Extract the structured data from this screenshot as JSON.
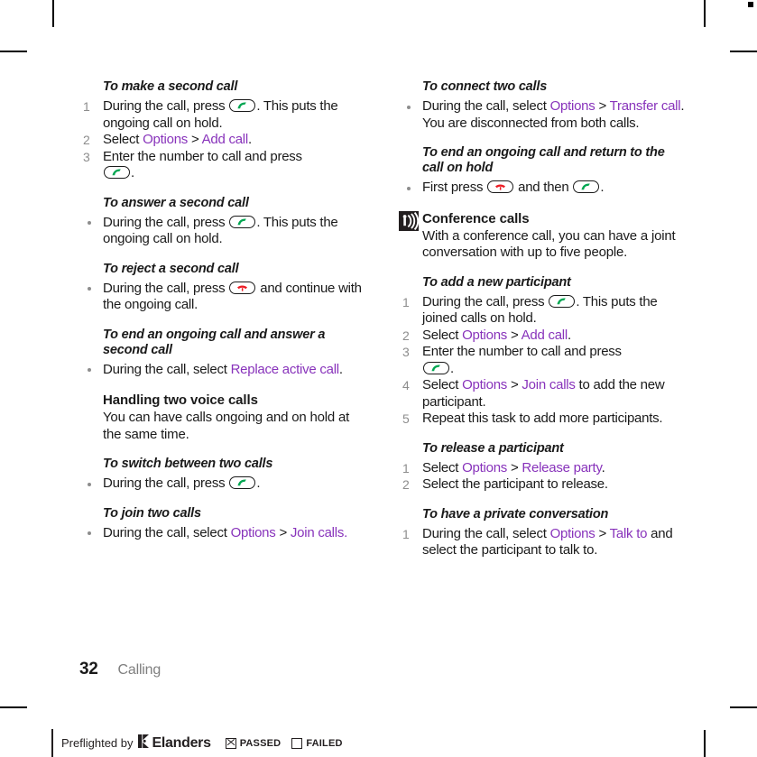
{
  "document": {
    "page_number": "32",
    "chapter": "Calling"
  },
  "left_column": {
    "blocks": [
      {
        "title": "To make a second call",
        "steps": [
          "During the call, press [CALL]. This puts the ongoing call on hold.",
          "Select Options > Add call.",
          "Enter the number to call and press [CALL]."
        ]
      },
      {
        "title": "To answer a second call",
        "steps": [
          "During the call, press [CALL]. This puts the ongoing call on hold."
        ]
      },
      {
        "title": "To reject a second call",
        "steps": [
          "During the call, press [END] and continue with the ongoing call."
        ]
      },
      {
        "title": "To end an ongoing call and answer a second call",
        "steps": [
          "During the call, select Replace active call."
        ]
      },
      {
        "heading": "Handling two voice calls",
        "body": "You can have calls ongoing and on hold at the same time."
      },
      {
        "title": "To switch between two calls",
        "steps": [
          "During the call, press [CALL]."
        ]
      },
      {
        "title": "To join two calls",
        "steps": [
          "During the call, select Options > Join calls."
        ]
      }
    ]
  },
  "right_column": {
    "blocks": [
      {
        "title": "To connect two calls",
        "steps": [
          "During the call, select Options > Transfer call. You are disconnected from both calls."
        ]
      },
      {
        "title": "To end an ongoing call and return to the call on hold",
        "steps": [
          "First press [END] and then [CALL]."
        ]
      },
      {
        "heading": "Conference calls",
        "body": "With a conference call, you can have a joint conversation with up to five people.",
        "icon": "conference-note-icon"
      },
      {
        "title": "To add a new participant",
        "steps": [
          "During the call, press [CALL]. This puts the joined calls on hold.",
          "Select Options > Add call.",
          "Enter the number to call and press [CALL].",
          "Select Options > Join calls to add the new participant.",
          "Repeat this task to add more participants."
        ]
      },
      {
        "title": "To release a participant",
        "steps": [
          "Select Options > Release party.",
          "Select the participant to release."
        ]
      },
      {
        "title": "To have a private conversation",
        "steps": [
          "During the call, select Options > Talk to and select the participant to talk to."
        ]
      }
    ]
  },
  "text": {
    "l1_title": "To make a second call",
    "l1_s1_a": "During the call, press ",
    "l1_s1_b": ". This puts the ongoing call on hold.",
    "l1_s2_a": "Select ",
    "l1_s2_opt": "Options",
    "l1_s2_gt": " > ",
    "l1_s2_add": "Add call",
    "l1_s2_end": ".",
    "l1_s3_a": "Enter the number to call and press ",
    "l1_s3_b": ".",
    "l2_title": "To answer a second call",
    "l2_s1_a": "During the call, press ",
    "l2_s1_b": ". This puts the ongoing call on hold.",
    "l3_title": "To reject a second call",
    "l3_s1_a": "During the call, press ",
    "l3_s1_b": " and continue with the ongoing call.",
    "l4_title": "To end an ongoing call and answer a second call",
    "l4_s1_a": "During the call, select ",
    "l4_s1_link": "Replace active call",
    "l4_s1_b": ".",
    "l5_heading": "Handling two voice calls",
    "l5_body": "You can have calls ongoing and on hold at the same time.",
    "l6_title": "To switch between two calls",
    "l6_s1_a": "During the call, press ",
    "l6_s1_b": ".",
    "l7_title": "To join two calls",
    "l7_s1_a": "During the call, select ",
    "l7_s1_opt": "Options",
    "l7_s1_gt": " > ",
    "l7_s1_join": "Join calls",
    "l7_s1_end": ".",
    "r1_title": "To connect two calls",
    "r1_s1_a": "During the call, select ",
    "r1_s1_opt": "Options",
    "r1_s1_gt": " > ",
    "r1_s1_transfer": "Transfer call",
    "r1_s1_b": ". You are disconnected from both calls.",
    "r2_title": "To end an ongoing call and return to the call on hold",
    "r2_s1_a": "First press ",
    "r2_s1_mid": " and then ",
    "r2_s1_b": ".",
    "r3_heading": "Conference calls",
    "r3_body": "With a conference call, you can have a joint conversation with up to five people.",
    "r4_title": "To add a new participant",
    "r4_s1_a": "During the call, press ",
    "r4_s1_b": ". This puts the joined calls on hold.",
    "r4_s2_a": "Select ",
    "r4_s2_opt": "Options",
    "r4_s2_gt": " > ",
    "r4_s2_add": "Add call",
    "r4_s2_end": ".",
    "r4_s3_a": "Enter the number to call and press ",
    "r4_s3_b": ".",
    "r4_s4_a": "Select ",
    "r4_s4_opt": "Options",
    "r4_s4_gt": " > ",
    "r4_s4_join": "Join calls",
    "r4_s4_b": " to add the new participant.",
    "r4_s5": "Repeat this task to add more participants.",
    "r5_title": "To release a participant",
    "r5_s1_a": "Select ",
    "r5_s1_opt": "Options",
    "r5_s1_gt": " > ",
    "r5_s1_rel": "Release party",
    "r5_s1_end": ".",
    "r5_s2": "Select the participant to release.",
    "r6_title": "To have a private conversation",
    "r6_s1_a": "During the call, select ",
    "r6_s1_opt": "Options",
    "r6_s1_gt": " > ",
    "r6_s1_talk": "Talk to",
    "r6_s1_b": " and select the participant to talk to."
  },
  "markers": {
    "n1": "1",
    "n2": "2",
    "n3": "3",
    "n4": "4",
    "n5": "5"
  },
  "preflight": {
    "text": "Preflighted by",
    "brand": "Elanders",
    "passed_label": "PASSED",
    "failed_label": "FAILED",
    "passed_checked": true,
    "failed_checked": false
  },
  "colors": {
    "ui_label_purple": "#8833bb",
    "call_key_green": "#00a651",
    "end_key_red": "#ed1c24",
    "marker_grey": "#8d8d8d",
    "chapter_grey": "#7f7f7f",
    "ink_black": "#1a1a1a"
  },
  "icons": {
    "call_key": "green-call-key-icon",
    "end_key": "red-end-call-key-icon",
    "conference_note": "conference-note-icon"
  }
}
